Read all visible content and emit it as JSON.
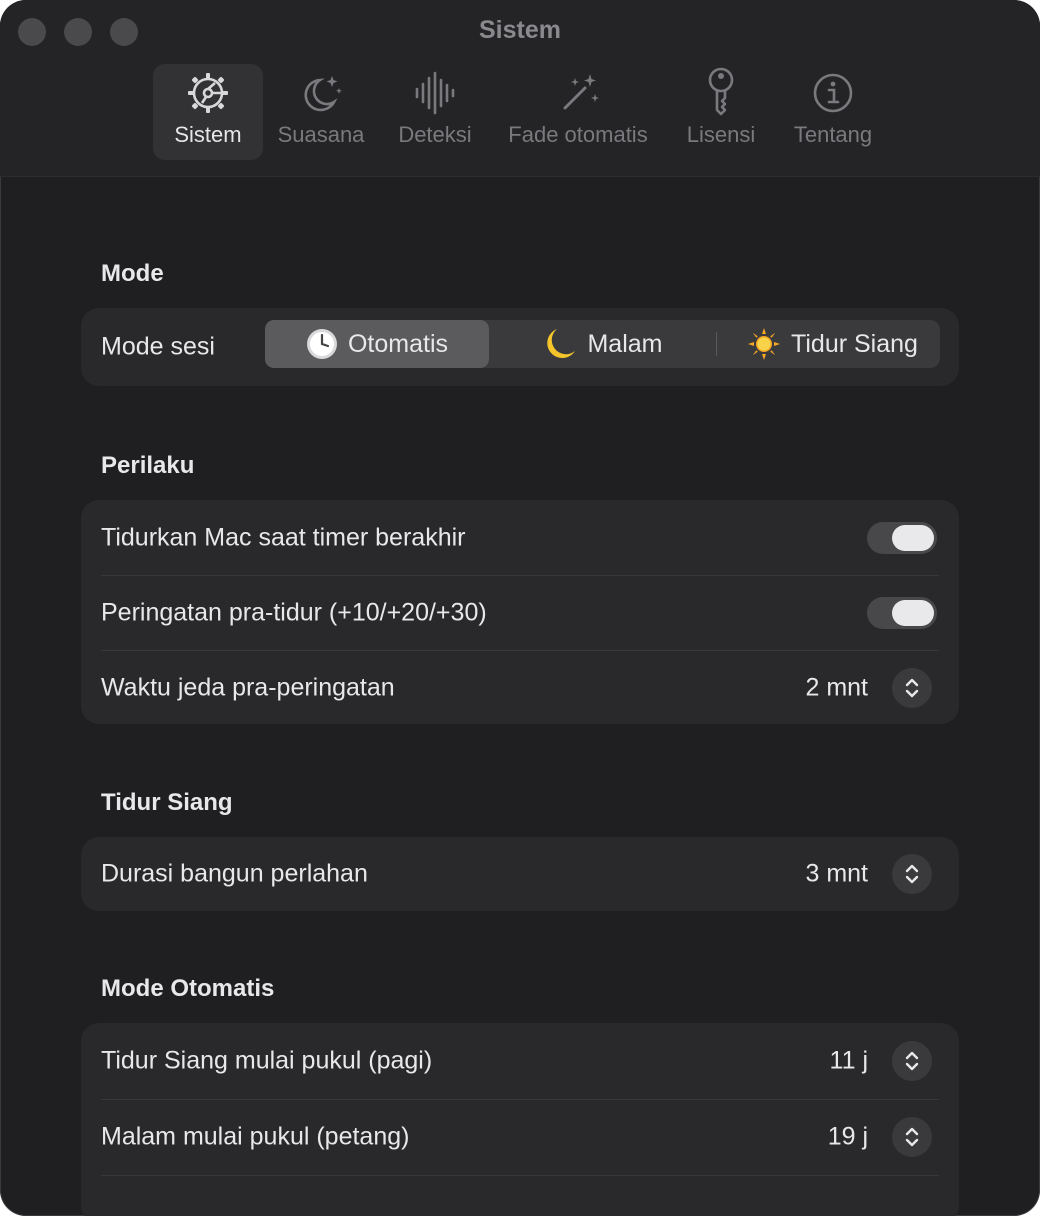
{
  "window": {
    "title": "Sistem"
  },
  "tabs": [
    {
      "label": "Sistem",
      "icon": "gear-icon",
      "active": true
    },
    {
      "label": "Suasana",
      "icon": "moon-stars-icon",
      "active": false
    },
    {
      "label": "Deteksi",
      "icon": "waveform-icon",
      "active": false
    },
    {
      "label": "Fade otomatis",
      "icon": "magic-wand-icon",
      "active": false
    },
    {
      "label": "Lisensi",
      "icon": "key-icon",
      "active": false
    },
    {
      "label": "Tentang",
      "icon": "info-icon",
      "active": false
    }
  ],
  "mode": {
    "title": "Mode",
    "session_label": "Mode sesi",
    "options": [
      {
        "label": "Otomatis",
        "icon": "clock-icon",
        "selected": true
      },
      {
        "label": "Malam",
        "icon": "crescent-moon-icon",
        "selected": false
      },
      {
        "label": "Tidur Siang",
        "icon": "sun-icon",
        "selected": false
      }
    ]
  },
  "behavior": {
    "title": "Perilaku",
    "sleep_mac_label": "Tidurkan Mac saat timer berakhir",
    "sleep_mac_on": true,
    "pre_warning_label": "Peringatan pra-tidur (+10/+20/+30)",
    "pre_warning_on": true,
    "pause_label": "Waktu jeda pra-peringatan",
    "pause_value": "2 mnt"
  },
  "nap": {
    "title": "Tidur Siang",
    "wake_label": "Durasi bangun perlahan",
    "wake_value": "3 mnt"
  },
  "auto_mode": {
    "title": "Mode Otomatis",
    "nap_start_label": "Tidur Siang mulai pukul (pagi)",
    "nap_start_value": "11 j",
    "night_start_label": "Malam mulai pukul (petang)",
    "night_start_value": "19 j"
  },
  "colors": {
    "background": "#1f1f21",
    "card": "#29292b",
    "text": "#e8e8ea",
    "muted": "#7a7a7e"
  }
}
